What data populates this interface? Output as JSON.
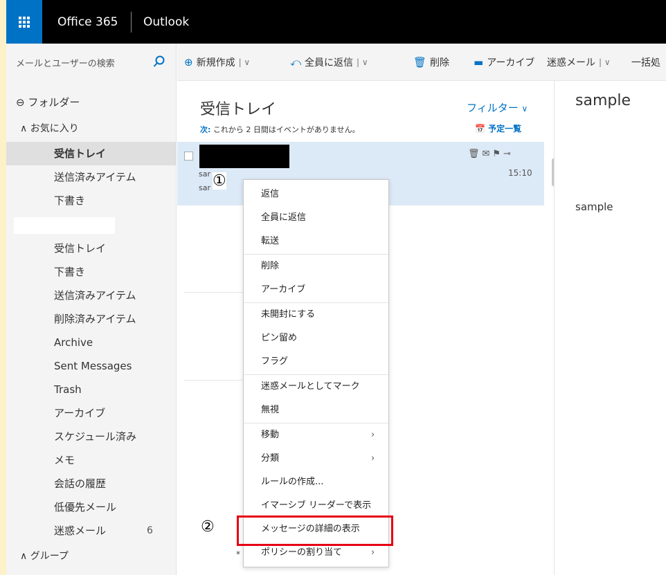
{
  "topbar": {
    "brand": "Office 365",
    "app": "Outlook"
  },
  "search": {
    "placeholder": "メールとユーザーの検索"
  },
  "toolbar": {
    "new": "新規作成",
    "reply_all": "全員に返信",
    "delete": "削除",
    "archive": "アーカイブ",
    "junk": "迷惑メール",
    "sweep": "一括処"
  },
  "nav": {
    "folders_header": "フォルダー",
    "favorites_header": "お気に入り",
    "favorites": [
      "受信トレイ",
      "送信済みアイテム",
      "下書き"
    ],
    "mailbox": [
      "受信トレイ",
      "下書き",
      "送信済みアイテム",
      "削除済みアイテム",
      "Archive",
      "Sent Messages",
      "Trash",
      "アーカイブ",
      "スケジュール済み",
      "メモ",
      "会話の履歴",
      "低優先メール"
    ],
    "junk": {
      "label": "迷惑メール",
      "count": "6"
    },
    "groups_header": "グループ"
  },
  "list": {
    "title": "受信トレイ",
    "filter": "フィルター",
    "events_prefix": "次:",
    "events_text": "これから 2 日間はイベントがありません。",
    "schedule": "予定一覧",
    "message": {
      "time": "15:10",
      "line1": "sar",
      "line2": "sar"
    },
    "stars": "*                                      *****************"
  },
  "markers": {
    "one": "①",
    "two": "②"
  },
  "pane": {
    "subject": "sample",
    "body": "sample"
  },
  "context_menu": {
    "items": [
      "返信",
      "全員に返信",
      "転送",
      "削除",
      "アーカイブ",
      "未開封にする",
      "ピン留め",
      "フラグ",
      "迷惑メールとしてマーク",
      "無視",
      "移動",
      "分類",
      "ルールの作成...",
      "イマーシブ リーダーで表示",
      "メッセージの詳細の表示",
      "ポリシーの割り当て"
    ]
  },
  "colors": {
    "accent": "#0072c6",
    "highlight": "#e60012",
    "selected_row": "#dce9f6"
  }
}
